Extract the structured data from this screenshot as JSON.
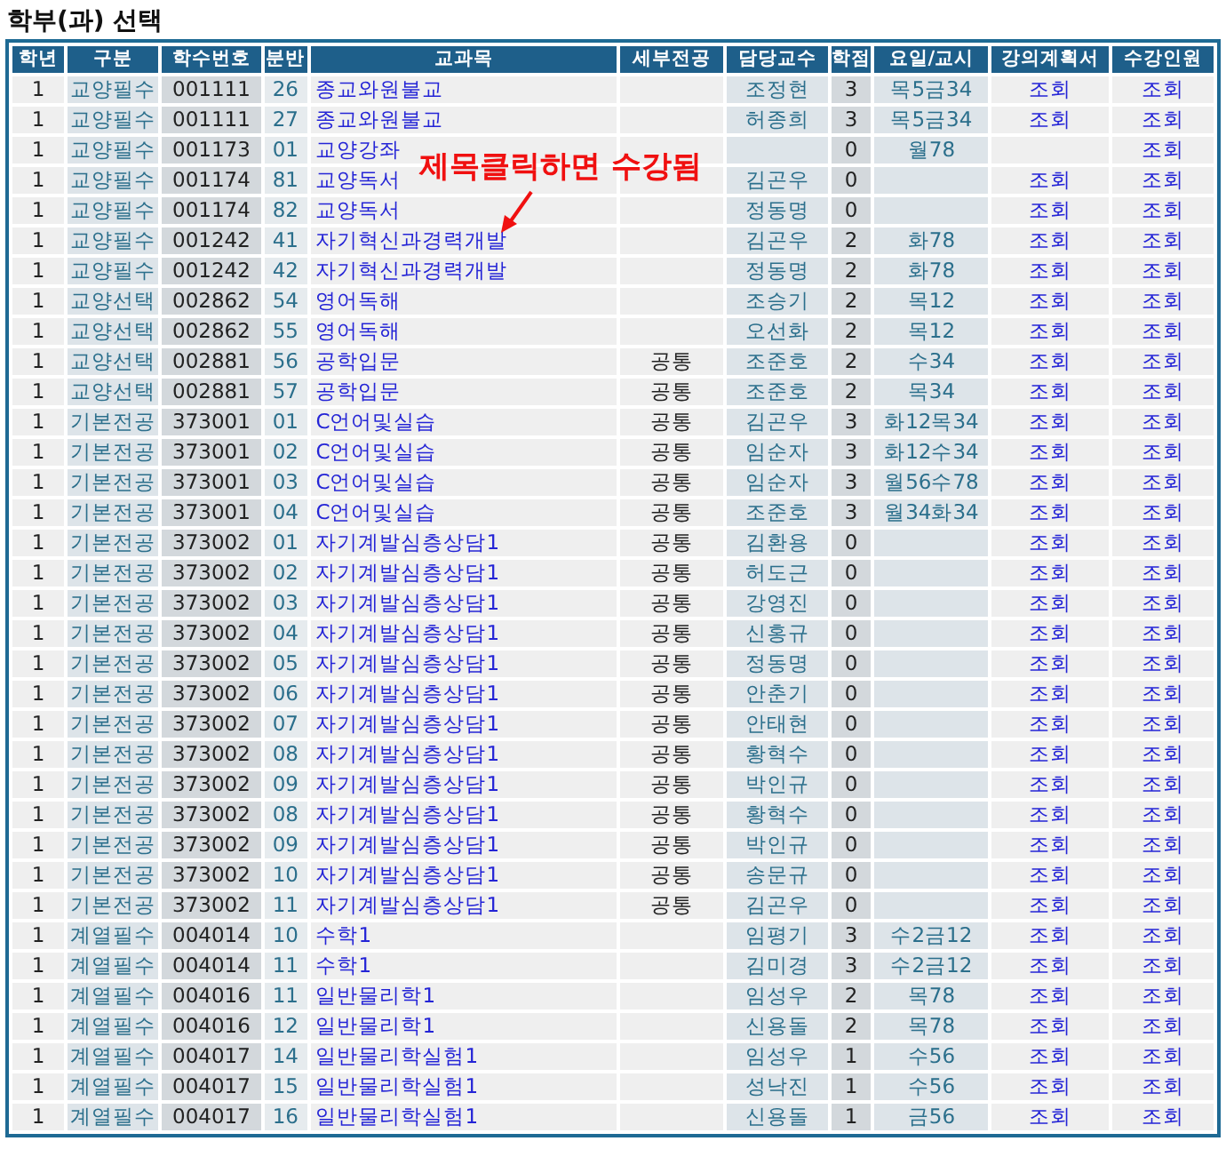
{
  "title": "학부(과) 선택",
  "columns": [
    "학년",
    "구분",
    "학수번호",
    "분반",
    "교과목",
    "세부전공",
    "담당교수",
    "학점",
    "요일/교시",
    "강의계획서",
    "수강인원"
  ],
  "rows": [
    {
      "year": "1",
      "category": "교양필수",
      "course_no": "001111",
      "section": "26",
      "course_name": "종교와원불교",
      "professor": "조정현",
      "credits": "3",
      "schedule": "목5금34",
      "syllabus": "조회",
      "enrollment": "조회"
    },
    {
      "year": "1",
      "category": "교양필수",
      "course_no": "001111",
      "section": "27",
      "course_name": "종교와원불교",
      "professor": "허종희",
      "credits": "3",
      "schedule": "목5금34",
      "syllabus": "조회",
      "enrollment": "조회"
    },
    {
      "year": "1",
      "category": "교양필수",
      "course_no": "001173",
      "section": "01",
      "course_name": "교양강좌",
      "credits": "0",
      "schedule": "월78",
      "enrollment": "조회"
    },
    {
      "year": "1",
      "category": "교양필수",
      "course_no": "001174",
      "section": "81",
      "course_name": "교양독서",
      "professor": "김곤우",
      "credits": "0",
      "syllabus": "조회",
      "enrollment": "조회"
    },
    {
      "year": "1",
      "category": "교양필수",
      "course_no": "001174",
      "section": "82",
      "course_name": "교양독서",
      "professor": "정동명",
      "credits": "0",
      "syllabus": "조회",
      "enrollment": "조회"
    },
    {
      "year": "1",
      "category": "교양필수",
      "course_no": "001242",
      "section": "41",
      "course_name": "자기혁신과경력개발",
      "professor": "김곤우",
      "credits": "2",
      "schedule": "화78",
      "syllabus": "조회",
      "enrollment": "조회"
    },
    {
      "year": "1",
      "category": "교양필수",
      "course_no": "001242",
      "section": "42",
      "course_name": "자기혁신과경력개발",
      "professor": "정동명",
      "credits": "2",
      "schedule": "화78",
      "syllabus": "조회",
      "enrollment": "조회"
    },
    {
      "year": "1",
      "category": "교양선택",
      "course_no": "002862",
      "section": "54",
      "course_name": "영어독해",
      "professor": "조승기",
      "credits": "2",
      "schedule": "목12",
      "syllabus": "조회",
      "enrollment": "조회"
    },
    {
      "year": "1",
      "category": "교양선택",
      "course_no": "002862",
      "section": "55",
      "course_name": "영어독해",
      "professor": "오선화",
      "credits": "2",
      "schedule": "목12",
      "syllabus": "조회",
      "enrollment": "조회"
    },
    {
      "year": "1",
      "category": "교양선택",
      "course_no": "002881",
      "section": "56",
      "course_name": "공학입문",
      "major_detail": "공통",
      "professor": "조준호",
      "credits": "2",
      "schedule": "수34",
      "syllabus": "조회",
      "enrollment": "조회"
    },
    {
      "year": "1",
      "category": "교양선택",
      "course_no": "002881",
      "section": "57",
      "course_name": "공학입문",
      "major_detail": "공통",
      "professor": "조준호",
      "credits": "2",
      "schedule": "목34",
      "syllabus": "조회",
      "enrollment": "조회"
    },
    {
      "year": "1",
      "category": "기본전공",
      "course_no": "373001",
      "section": "01",
      "course_name": "C언어및실습",
      "major_detail": "공통",
      "professor": "김곤우",
      "credits": "3",
      "schedule": "화12목34",
      "syllabus": "조회",
      "enrollment": "조회"
    },
    {
      "year": "1",
      "category": "기본전공",
      "course_no": "373001",
      "section": "02",
      "course_name": "C언어및실습",
      "major_detail": "공통",
      "professor": "임순자",
      "credits": "3",
      "schedule": "화12수34",
      "syllabus": "조회",
      "enrollment": "조회"
    },
    {
      "year": "1",
      "category": "기본전공",
      "course_no": "373001",
      "section": "03",
      "course_name": "C언어및실습",
      "major_detail": "공통",
      "professor": "임순자",
      "credits": "3",
      "schedule": "월56수78",
      "syllabus": "조회",
      "enrollment": "조회"
    },
    {
      "year": "1",
      "category": "기본전공",
      "course_no": "373001",
      "section": "04",
      "course_name": "C언어및실습",
      "major_detail": "공통",
      "professor": "조준호",
      "credits": "3",
      "schedule": "월34화34",
      "syllabus": "조회",
      "enrollment": "조회"
    },
    {
      "year": "1",
      "category": "기본전공",
      "course_no": "373002",
      "section": "01",
      "course_name": "자기계발심층상담1",
      "major_detail": "공통",
      "professor": "김환용",
      "credits": "0",
      "syllabus": "조회",
      "enrollment": "조회"
    },
    {
      "year": "1",
      "category": "기본전공",
      "course_no": "373002",
      "section": "02",
      "course_name": "자기계발심층상담1",
      "major_detail": "공통",
      "professor": "허도근",
      "credits": "0",
      "syllabus": "조회",
      "enrollment": "조회"
    },
    {
      "year": "1",
      "category": "기본전공",
      "course_no": "373002",
      "section": "03",
      "course_name": "자기계발심층상담1",
      "major_detail": "공통",
      "professor": "강영진",
      "credits": "0",
      "syllabus": "조회",
      "enrollment": "조회"
    },
    {
      "year": "1",
      "category": "기본전공",
      "course_no": "373002",
      "section": "04",
      "course_name": "자기계발심층상담1",
      "major_detail": "공통",
      "professor": "신홍규",
      "credits": "0",
      "syllabus": "조회",
      "enrollment": "조회"
    },
    {
      "year": "1",
      "category": "기본전공",
      "course_no": "373002",
      "section": "05",
      "course_name": "자기계발심층상담1",
      "major_detail": "공통",
      "professor": "정동명",
      "credits": "0",
      "syllabus": "조회",
      "enrollment": "조회"
    },
    {
      "year": "1",
      "category": "기본전공",
      "course_no": "373002",
      "section": "06",
      "course_name": "자기계발심층상담1",
      "major_detail": "공통",
      "professor": "안춘기",
      "credits": "0",
      "syllabus": "조회",
      "enrollment": "조회"
    },
    {
      "year": "1",
      "category": "기본전공",
      "course_no": "373002",
      "section": "07",
      "course_name": "자기계발심층상담1",
      "major_detail": "공통",
      "professor": "안태현",
      "credits": "0",
      "syllabus": "조회",
      "enrollment": "조회"
    },
    {
      "year": "1",
      "category": "기본전공",
      "course_no": "373002",
      "section": "08",
      "course_name": "자기계발심층상담1",
      "major_detail": "공통",
      "professor": "황혁수",
      "credits": "0",
      "syllabus": "조회",
      "enrollment": "조회"
    },
    {
      "year": "1",
      "category": "기본전공",
      "course_no": "373002",
      "section": "09",
      "course_name": "자기계발심층상담1",
      "major_detail": "공통",
      "professor": "박인규",
      "credits": "0",
      "syllabus": "조회",
      "enrollment": "조회"
    },
    {
      "year": "1",
      "category": "기본전공",
      "course_no": "373002",
      "section": "08",
      "course_name": "자기계발심층상담1",
      "major_detail": "공통",
      "professor": "황혁수",
      "credits": "0",
      "syllabus": "조회",
      "enrollment": "조회"
    },
    {
      "year": "1",
      "category": "기본전공",
      "course_no": "373002",
      "section": "09",
      "course_name": "자기계발심층상담1",
      "major_detail": "공통",
      "professor": "박인규",
      "credits": "0",
      "syllabus": "조회",
      "enrollment": "조회"
    },
    {
      "year": "1",
      "category": "기본전공",
      "course_no": "373002",
      "section": "10",
      "course_name": "자기계발심층상담1",
      "major_detail": "공통",
      "professor": "송문규",
      "credits": "0",
      "syllabus": "조회",
      "enrollment": "조회"
    },
    {
      "year": "1",
      "category": "기본전공",
      "course_no": "373002",
      "section": "11",
      "course_name": "자기계발심층상담1",
      "major_detail": "공통",
      "professor": "김곤우",
      "credits": "0",
      "syllabus": "조회",
      "enrollment": "조회"
    },
    {
      "year": "1",
      "category": "계열필수",
      "course_no": "004014",
      "section": "10",
      "course_name": "수학1",
      "professor": "임평기",
      "credits": "3",
      "schedule": "수2금12",
      "syllabus": "조회",
      "enrollment": "조회"
    },
    {
      "year": "1",
      "category": "계열필수",
      "course_no": "004014",
      "section": "11",
      "course_name": "수학1",
      "professor": "김미경",
      "credits": "3",
      "schedule": "수2금12",
      "syllabus": "조회",
      "enrollment": "조회"
    },
    {
      "year": "1",
      "category": "계열필수",
      "course_no": "004016",
      "section": "11",
      "course_name": "일반물리학1",
      "professor": "임성우",
      "credits": "2",
      "schedule": "목78",
      "syllabus": "조회",
      "enrollment": "조회"
    },
    {
      "year": "1",
      "category": "계열필수",
      "course_no": "004016",
      "section": "12",
      "course_name": "일반물리학1",
      "professor": "신용돌",
      "credits": "2",
      "schedule": "목78",
      "syllabus": "조회",
      "enrollment": "조회"
    },
    {
      "year": "1",
      "category": "계열필수",
      "course_no": "004017",
      "section": "14",
      "course_name": "일반물리학실험1",
      "professor": "임성우",
      "credits": "1",
      "schedule": "수56",
      "syllabus": "조회",
      "enrollment": "조회"
    },
    {
      "year": "1",
      "category": "계열필수",
      "course_no": "004017",
      "section": "15",
      "course_name": "일반물리학실험1",
      "professor": "성낙진",
      "credits": "1",
      "schedule": "수56",
      "syllabus": "조회",
      "enrollment": "조회"
    },
    {
      "year": "1",
      "category": "계열필수",
      "course_no": "004017",
      "section": "16",
      "course_name": "일반물리학실험1",
      "professor": "신용돌",
      "credits": "1",
      "schedule": "금56",
      "syllabus": "조회",
      "enrollment": "조회"
    }
  ],
  "annotation": {
    "text": "제목클릭하면 수강됨"
  }
}
